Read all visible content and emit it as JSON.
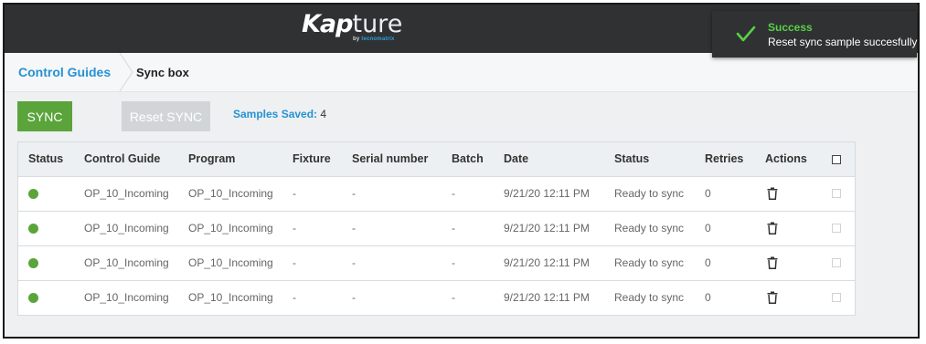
{
  "header": {
    "logo_main": "Kap",
    "logo_rest": "ture",
    "logo_by": "by ",
    "logo_brand": "tecnomatrix"
  },
  "breadcrumb": {
    "parent": "Control Guides",
    "current": "Sync box"
  },
  "toolbar": {
    "sync_label": "SYNC",
    "reset_label": "Reset SYNC",
    "saved_label": "Samples Saved:",
    "saved_count": "4"
  },
  "table": {
    "headers": {
      "status": "Status",
      "control_guide": "Control Guide",
      "program": "Program",
      "fixture": "Fixture",
      "serial": "Serial number",
      "batch": "Batch",
      "date": "Date",
      "sync_status": "Status",
      "retries": "Retries",
      "actions": "Actions"
    },
    "rows": [
      {
        "control_guide": "OP_10_Incoming",
        "program": "OP_10_Incoming",
        "fixture": "-",
        "serial": "-",
        "batch": "-",
        "date": "9/21/20 12:11 PM",
        "status": "Ready to sync",
        "retries": "0"
      },
      {
        "control_guide": "OP_10_Incoming",
        "program": "OP_10_Incoming",
        "fixture": "-",
        "serial": "-",
        "batch": "-",
        "date": "9/21/20 12:11 PM",
        "status": "Ready to sync",
        "retries": "0"
      },
      {
        "control_guide": "OP_10_Incoming",
        "program": "OP_10_Incoming",
        "fixture": "-",
        "serial": "-",
        "batch": "-",
        "date": "9/21/20 12:11 PM",
        "status": "Ready to sync",
        "retries": "0"
      },
      {
        "control_guide": "OP_10_Incoming",
        "program": "OP_10_Incoming",
        "fixture": "-",
        "serial": "-",
        "batch": "-",
        "date": "9/21/20 12:11 PM",
        "status": "Ready to sync",
        "retries": "0"
      }
    ]
  },
  "toast": {
    "title": "Success",
    "message": "Reset sync sample succesfully"
  },
  "colors": {
    "header_bg": "#2f3133",
    "accent_blue": "#2592d4",
    "sync_green": "#5aa43b",
    "status_dot_green": "#5aa43b",
    "toast_title_green": "#58d145"
  },
  "icons": [
    "trash-icon",
    "check-icon",
    "status-dot"
  ]
}
